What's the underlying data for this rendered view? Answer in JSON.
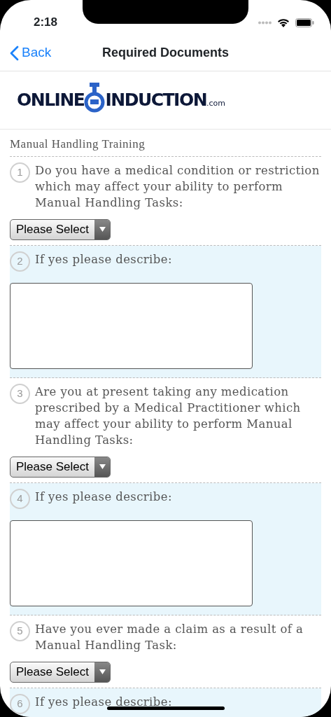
{
  "status_bar": {
    "time": "2:18"
  },
  "nav": {
    "back": "Back",
    "title": "Required Documents"
  },
  "logo": {
    "left": "ONLINE",
    "right": "INDUCTION",
    "suffix": ".com"
  },
  "section_title": "Manual Handling Training",
  "questions": [
    {
      "number": "1",
      "text": "Do you have a medical condition or restriction which may affect your ability to perform Manual Handling Tasks:",
      "kind": "select",
      "value": "Please Select",
      "shaded": false
    },
    {
      "number": "2",
      "text": "If yes please describe:",
      "kind": "textarea",
      "shaded": true
    },
    {
      "number": "3",
      "text": "Are you at present taking any medication prescribed by a Medical Practitioner which may affect your ability to perform Manual Handling Tasks:",
      "kind": "select",
      "value": "Please Select",
      "shaded": false
    },
    {
      "number": "4",
      "text": "If yes please describe:",
      "kind": "textarea",
      "shaded": true
    },
    {
      "number": "5",
      "text": "Have you ever made a claim as a result of a Manual Handling Task:",
      "kind": "select",
      "value": "Please Select",
      "shaded": false
    },
    {
      "number": "6",
      "text": "If yes please describe:",
      "shaded": true
    }
  ]
}
